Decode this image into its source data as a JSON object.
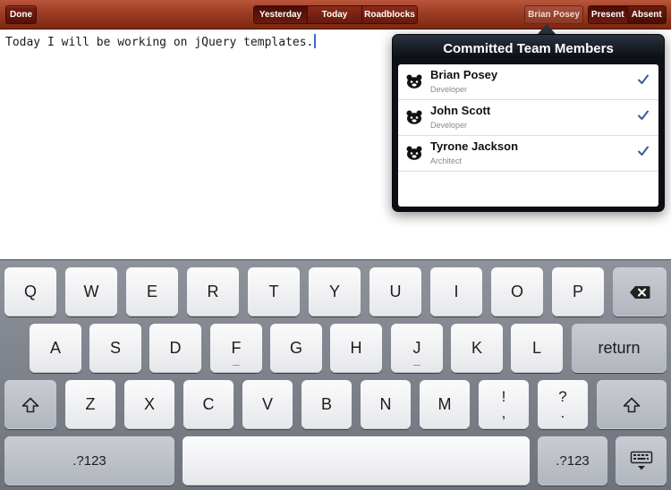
{
  "toolbar": {
    "done_label": "Done",
    "segments": [
      {
        "label": "Yesterday",
        "selected": true
      },
      {
        "label": "Today",
        "selected": false
      },
      {
        "label": "Roadblocks",
        "selected": false
      }
    ],
    "user_label": "Brian Posey",
    "status_segments": [
      {
        "label": "Present",
        "selected": true
      },
      {
        "label": "Absent",
        "selected": false
      }
    ]
  },
  "note": {
    "text": "Today I will be working on jQuery templates."
  },
  "popover": {
    "title": "Committed Team Members",
    "members": [
      {
        "name": "Brian Posey",
        "role": "Developer",
        "checked": true
      },
      {
        "name": "John Scott",
        "role": "Developer",
        "checked": true
      },
      {
        "name": "Tyrone Jackson",
        "role": "Architect",
        "checked": true
      }
    ]
  },
  "keyboard": {
    "row1": [
      "Q",
      "W",
      "E",
      "R",
      "T",
      "Y",
      "U",
      "I",
      "O",
      "P"
    ],
    "row2": [
      "A",
      "S",
      "D",
      "F",
      "G",
      "H",
      "J",
      "K",
      "L"
    ],
    "row3": [
      "Z",
      "X",
      "C",
      "V",
      "B",
      "N",
      "M"
    ],
    "return_label": "return",
    "numbers_label": ".?123",
    "punct1": [
      "!",
      ","
    ],
    "punct2": [
      "?",
      "."
    ],
    "icons": {
      "backspace": "backspace-icon",
      "shift": "shift-icon",
      "hide": "keyboard-hide-icon"
    }
  },
  "colors": {
    "toolbar": "#9a3a22",
    "popover": "#0e1218",
    "check": "#3a5a9a",
    "caret": "#3b6ccc"
  }
}
